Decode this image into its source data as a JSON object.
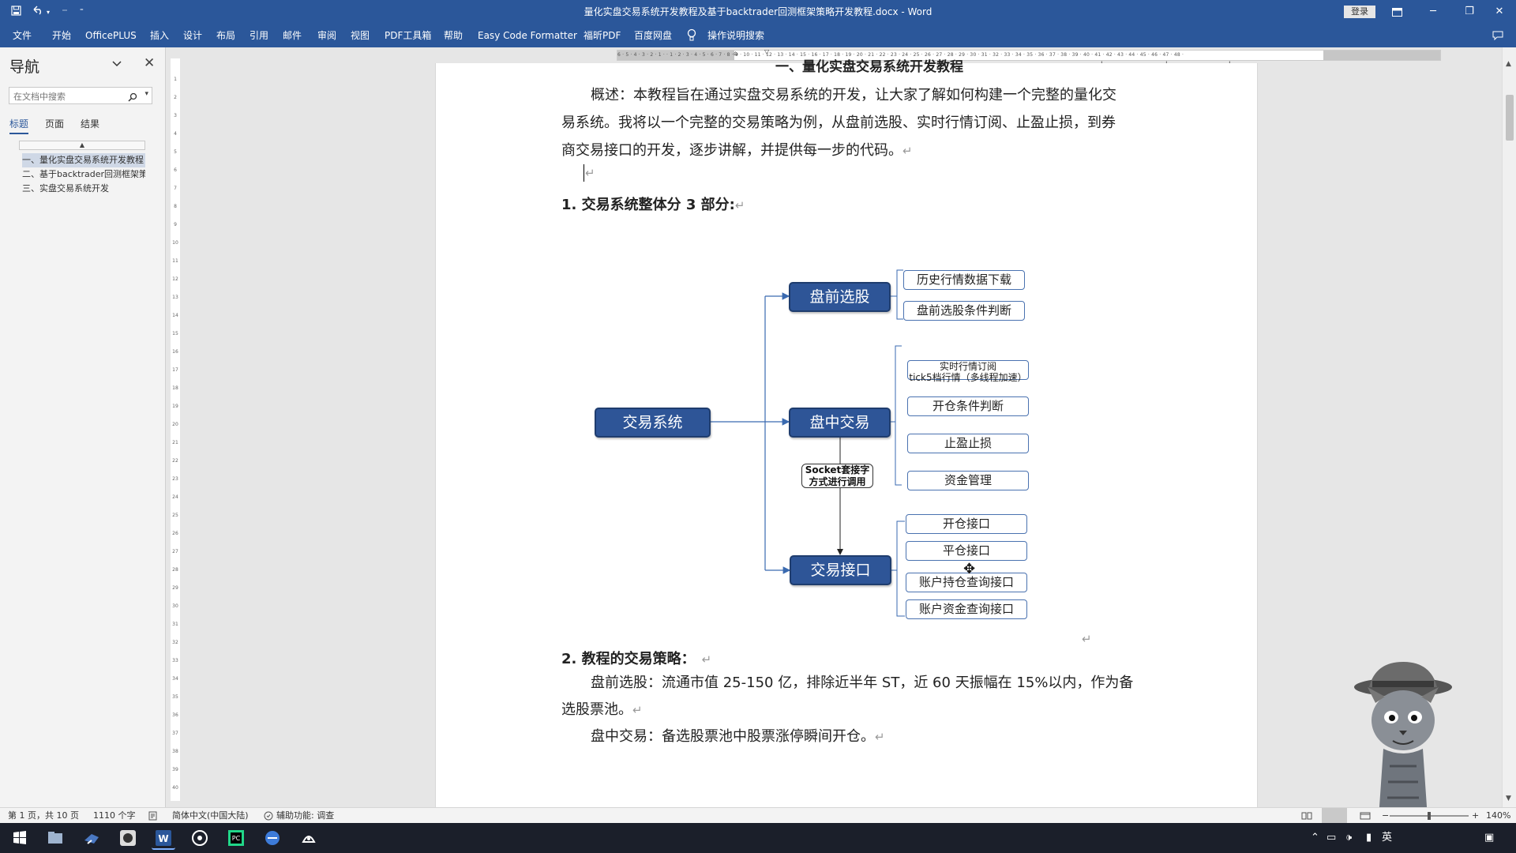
{
  "titlebar": {
    "title": "量化实盘交易系统开发教程及基于backtrader回测框架策略开发教程.docx  -  Word",
    "login": "登录",
    "quick_access": [
      "save-icon",
      "undo-icon",
      "redo-icon",
      "customize-icon"
    ]
  },
  "menu": {
    "items": [
      "文件",
      "开始",
      "OfficePLUS",
      "插入",
      "设计",
      "布局",
      "引用",
      "邮件",
      "审阅",
      "视图",
      "PDF工具箱",
      "帮助",
      "Easy Code Formatter",
      "福昕PDF",
      "百度网盘"
    ],
    "tell_me": "操作说明搜索"
  },
  "nav": {
    "title": "导航",
    "search_placeholder": "在文档中搜索",
    "tabs": [
      "标题",
      "页面",
      "结果"
    ],
    "headings": [
      "一、量化实盘交易系统开发教程",
      "二、基于backtrader回测框架策略开发教程",
      "三、实盘交易系统开发"
    ]
  },
  "document": {
    "cut_heading": "一、量化实盘交易系统开发教程",
    "intro_line1": "概述：本教程旨在通过实盘交易系统的开发，让大家了解如何构建一个完整的量化交",
    "intro_line2": "易系统。我将以一个完整的交易策略为例，从盘前选股、实时行情订阅、止盈止损，到券",
    "intro_line3": "商交易接口的开发，逐步讲解，并提供每一步的代码。",
    "section1": "1.   交易系统整体分 3 部分:",
    "section2": "2.   教程的交易策略：",
    "strategy_line1": "盘前选股：流通市值 25-150 亿，排除近半年 ST，近 60 天振幅在 15%以内，作为备",
    "strategy_line2": "选股票池。",
    "strategy_line3": "盘中交易：备选股票池中股票涨停瞬间开仓。",
    "paragraph_mark": "↵"
  },
  "diagram": {
    "root": "交易系统",
    "premarket": "盘前选股",
    "intraday": "盘中交易",
    "interface": "交易接口",
    "premarket_items": [
      "历史行情数据下载",
      "盘前选股条件判断"
    ],
    "intraday_items": [
      "实时行情订阅",
      "tick5档行情（多线程加速）",
      "开仓条件判断",
      "止盈止损",
      "资金管理"
    ],
    "interface_items": [
      "开仓接口",
      "平仓接口",
      "账户持仓查询接口",
      "账户资金查询接口"
    ],
    "callout_line1": "Socket套接字",
    "callout_line2": "方式进行调用",
    "box_color": "#2e5597"
  },
  "status": {
    "page": "第 1 页，共 10 页",
    "words": "1110 个字",
    "language": "简体中文(中国大陆)",
    "accessibility": "辅助功能: 调查",
    "zoom": "140%"
  },
  "taskbar": {
    "ime": "英",
    "apps": [
      "start-icon",
      "file-explorer-icon",
      "app-icon",
      "app-icon",
      "word-icon",
      "app-icon",
      "pycharm-icon",
      "app-icon",
      "app-icon"
    ]
  },
  "colors": {
    "word_blue": "#2b579a",
    "diagram_blue": "#2e5597"
  }
}
